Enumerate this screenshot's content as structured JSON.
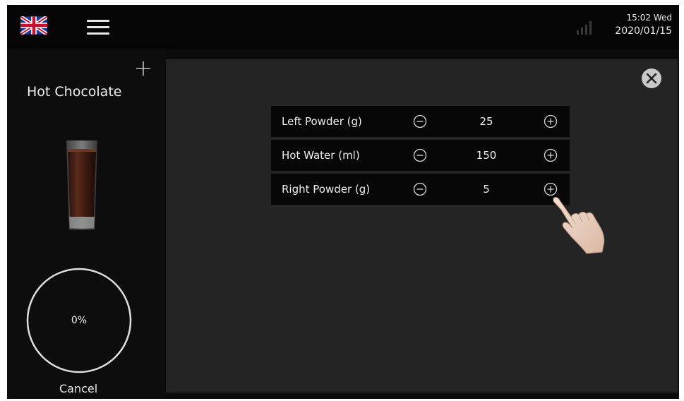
{
  "header": {
    "language_flag": "uk-flag-icon",
    "menu_icon": "hamburger-menu-icon",
    "signal_icon": "signal-bars-icon",
    "time": "15:02 Wed",
    "date": "2020/01/15"
  },
  "drink": {
    "name": "Hot Chocolate",
    "add_icon": "plus-icon",
    "image_icon": "glass-of-hot-chocolate",
    "progress": 0,
    "progress_label": "0%",
    "cancel_label": "Cancel"
  },
  "recipe": {
    "close_icon": "close-circle-icon",
    "rows": [
      {
        "label": "Left Powder (g)",
        "value": "25"
      },
      {
        "label": "Hot Water (ml)",
        "value": "150"
      },
      {
        "label": "Right Powder (g)",
        "value": "5"
      }
    ]
  },
  "pointer_icon": "pointing-hand-icon",
  "colors": {
    "screen_bg": "#0b0b0b",
    "panel_bg": "#242424",
    "row_bg": "#070707",
    "text": "#eeeeee"
  }
}
